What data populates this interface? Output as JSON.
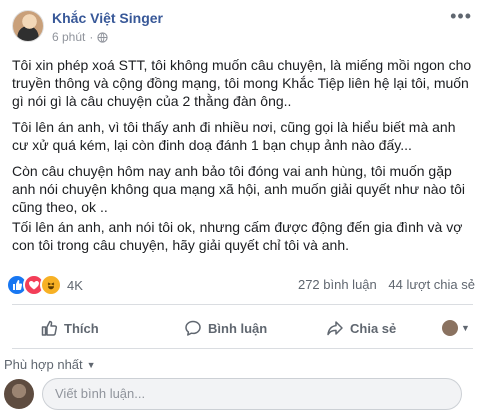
{
  "post": {
    "author": "Khắc Việt Singer",
    "timestamp": "6 phút",
    "paragraphs": [
      "Tôi xin phép xoá STT, tôi không muốn câu chuyện, là miếng mồi ngon cho truyền thông và cộng đồng mạng, tôi mong Khắc Tiệp liên hệ lại tôi, muốn gì nói gì là câu chuyện của 2 thằng đàn ông..",
      "Tôi lên án anh, vì tôi thấy anh đi nhiều nơi, cũng gọi là hiểu biết mà anh cư xử quá kém, lại còn đinh doạ đánh 1 bạn chụp ảnh nào đấy...",
      "Còn câu chuyện hôm nay anh bảo tôi đóng vai anh hùng, tôi muốn gặp anh nói chuyện không qua mạng xã hội, anh muốn giải quyết như nào tôi cũng theo, ok ..",
      "Tối lên án anh, anh nói tôi ok, nhưng cấm được động đến gia đình và vợ con tôi trong câu chuyện, hãy giải quyết chỉ tôi và anh."
    ]
  },
  "stats": {
    "reaction_count": "4K",
    "comments": "272 bình luận",
    "shares": "44 lượt chia sẻ"
  },
  "actions": {
    "like": "Thích",
    "comment": "Bình luận",
    "share": "Chia sẻ"
  },
  "comments_section": {
    "sort_label": "Phù hợp nhất",
    "input_placeholder": "Viết bình luận..."
  },
  "colors": {
    "link": "#385898",
    "like": "#1877f2",
    "love": "#f33e58",
    "haha": "#f7b125"
  }
}
